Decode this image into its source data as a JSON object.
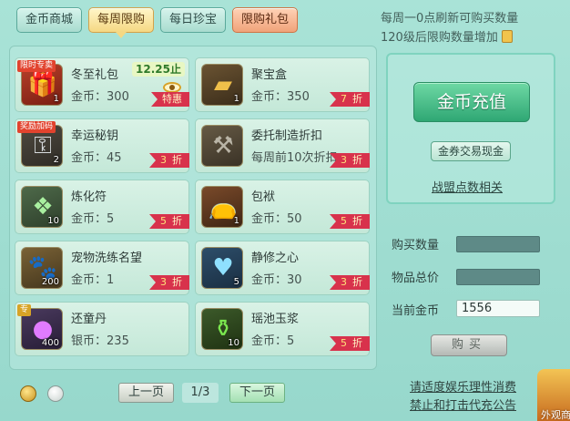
{
  "tabs": [
    {
      "label": "金币商城",
      "state": "normal"
    },
    {
      "label": "每周限购",
      "state": "active"
    },
    {
      "label": "每日珍宝",
      "state": "normal"
    },
    {
      "label": "限购礼包",
      "state": "limit"
    }
  ],
  "notice": {
    "line1": "每周一0点刷新可购买数量",
    "line2": "120级后限购数量增加"
  },
  "items": [
    {
      "name": "冬至礼包",
      "currency": "金币",
      "price": "300",
      "qty": "1",
      "tag": "限时专卖",
      "timer": "12.25止",
      "ribbon": "特惠",
      "icon": "gift-box-icon"
    },
    {
      "name": "聚宝盒",
      "currency": "金币",
      "price": "350",
      "qty": "1",
      "ribbon_num": "7",
      "ribbon": "折",
      "icon": "treasure-box-icon"
    },
    {
      "name": "幸运秘钥",
      "currency": "金币",
      "price": "45",
      "qty": "2",
      "tag": "奖励加码",
      "ribbon_num": "3",
      "ribbon": "折",
      "icon": "key-icon"
    },
    {
      "name": "委托制造折扣",
      "currency": "",
      "price": "每周前10次折扣",
      "qty": "",
      "ribbon_num": "3",
      "ribbon": "折",
      "icon": "hammer-icon"
    },
    {
      "name": "炼化符",
      "currency": "金币",
      "price": "5",
      "qty": "10",
      "ribbon_num": "5",
      "ribbon": "折",
      "icon": "talisman-icon"
    },
    {
      "name": "包袱",
      "currency": "金币",
      "price": "50",
      "qty": "1",
      "ribbon_num": "5",
      "ribbon": "折",
      "icon": "bag-icon"
    },
    {
      "name": "宠物洗练名望",
      "currency": "金币",
      "price": "1",
      "qty": "200",
      "ribbon_num": "3",
      "ribbon": "折",
      "icon": "paw-scroll-icon"
    },
    {
      "name": "静修之心",
      "currency": "金币",
      "price": "30",
      "qty": "5",
      "ribbon_num": "3",
      "ribbon": "折",
      "icon": "heart-crystal-icon"
    },
    {
      "name": "还童丹",
      "currency": "银币",
      "price": "235",
      "qty": "400",
      "tag": "专",
      "ribbon_num": "",
      "ribbon": "",
      "icon": "purple-pill-icon"
    },
    {
      "name": "瑶池玉浆",
      "currency": "金币",
      "price": "5",
      "qty": "10",
      "ribbon_num": "5",
      "ribbon": "折",
      "icon": "green-potion-icon"
    }
  ],
  "pager": {
    "prev_label": "上一页",
    "page": "1/3",
    "next_label": "下一页"
  },
  "right": {
    "recharge_label": "金币充值",
    "exchange_label": "金券交易现金",
    "guild_link": "战盟点数相关",
    "qty_label": "购买数量",
    "total_label": "物品总价",
    "coin_label": "当前金币",
    "coin_value": "1556",
    "buy_label": "购买"
  },
  "footer": {
    "line1": "请适度娱乐理性消费",
    "line2": "禁止和打击代充公告"
  },
  "corner": {
    "label": "外观商"
  }
}
